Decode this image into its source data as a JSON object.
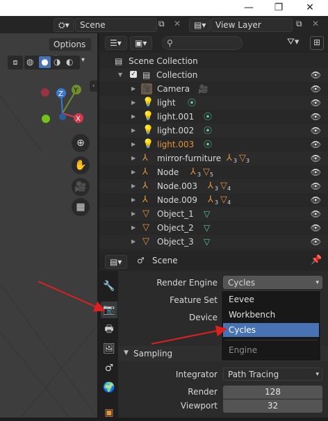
{
  "window": {
    "minimize": "—",
    "restore": "❐",
    "close": "✕"
  },
  "topbar": {
    "scene_label": "Scene",
    "viewlayer_label": "View Layer"
  },
  "viewport": {
    "options_label": "Options"
  },
  "outliner": {
    "scene_collection": "Scene Collection",
    "rows": [
      {
        "label": "Collection"
      },
      {
        "label": "Camera"
      },
      {
        "label": "light"
      },
      {
        "label": "light.001"
      },
      {
        "label": "light.002"
      },
      {
        "label": "light.003"
      },
      {
        "label": "mirror-furniture",
        "badge1": "3",
        "badge2": "3"
      },
      {
        "label": "Node",
        "badge1": "3",
        "badge2": "5"
      },
      {
        "label": "Node.003",
        "badge1": "3",
        "badge2": "4"
      },
      {
        "label": "Node.009",
        "badge1": "3",
        "badge2": "4"
      },
      {
        "label": "Object_1"
      },
      {
        "label": "Object_2"
      },
      {
        "label": "Object_3"
      }
    ],
    "highlight_color": "#e0953e"
  },
  "properties": {
    "header_title": "Scene",
    "render_engine_label": "Render Engine",
    "render_engine_value": "Cycles",
    "feature_set_label": "Feature Set",
    "device_label": "Device",
    "sampling_label": "Sampling",
    "integrator_label": "Integrator",
    "integrator_value": "Path Tracing",
    "render_label": "Render",
    "render_value": "128",
    "viewport_label": "Viewport",
    "viewport_value": "32"
  },
  "engine_menu": {
    "items": [
      "Eevee",
      "Workbench",
      "Cycles"
    ],
    "selected": "Cycles",
    "footer": "Engine"
  },
  "colors": {
    "accent": "#4772b3",
    "arrow": "#e02020"
  }
}
